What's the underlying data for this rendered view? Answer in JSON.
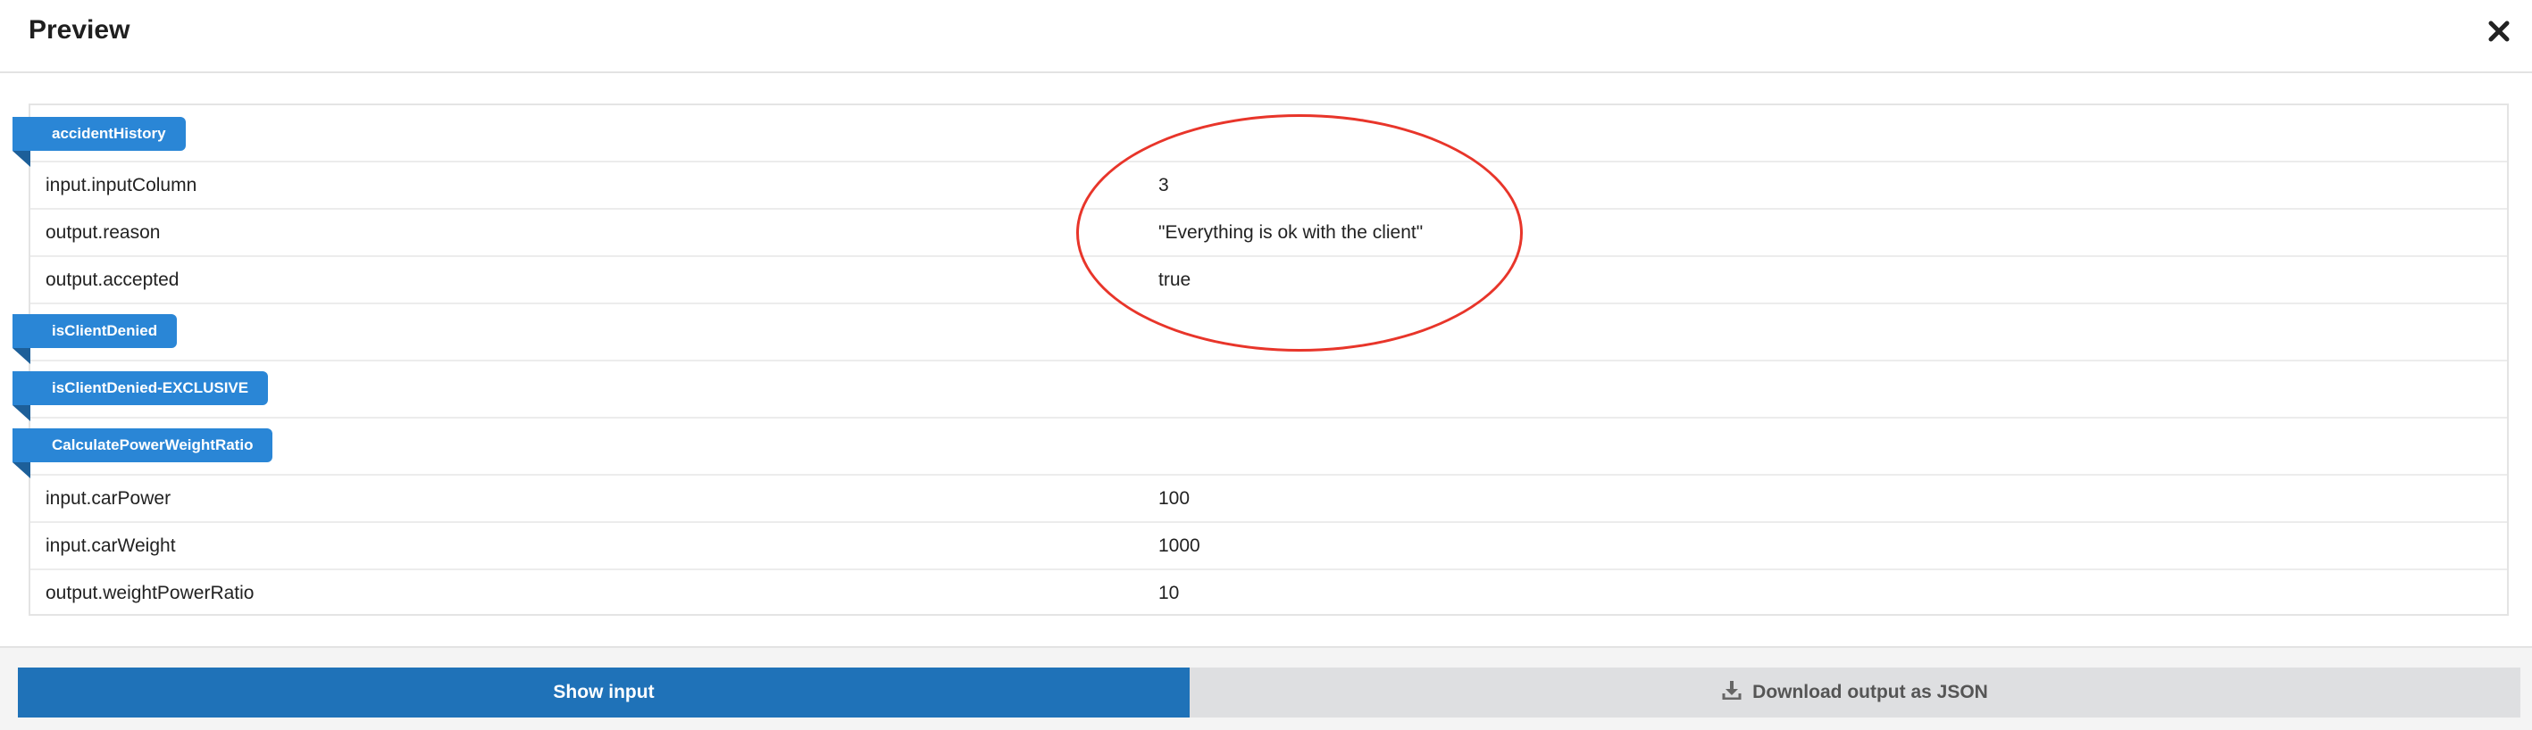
{
  "header": {
    "title": "Preview",
    "close_icon": "close-icon"
  },
  "sections": [
    {
      "name": "accidentHistory",
      "rows": [
        {
          "key": "input.inputColumn",
          "value": "3"
        },
        {
          "key": "output.reason",
          "value": "\"Everything is ok with the client\""
        },
        {
          "key": "output.accepted",
          "value": "true"
        }
      ]
    },
    {
      "name": "isClientDenied",
      "rows": []
    },
    {
      "name": "isClientDenied-EXCLUSIVE",
      "rows": []
    },
    {
      "name": "CalculatePowerWeightRatio",
      "rows": [
        {
          "key": "input.carPower",
          "value": "100"
        },
        {
          "key": "input.carWeight",
          "value": "1000"
        },
        {
          "key": "output.weightPowerRatio",
          "value": "10"
        }
      ]
    }
  ],
  "footer": {
    "show_input_label": "Show input",
    "download_label": "Download output as JSON",
    "download_icon": "download-icon"
  },
  "colors": {
    "accent": "#2a86d6",
    "primary_button": "#1f72b8",
    "annotation": "#e8352a"
  }
}
